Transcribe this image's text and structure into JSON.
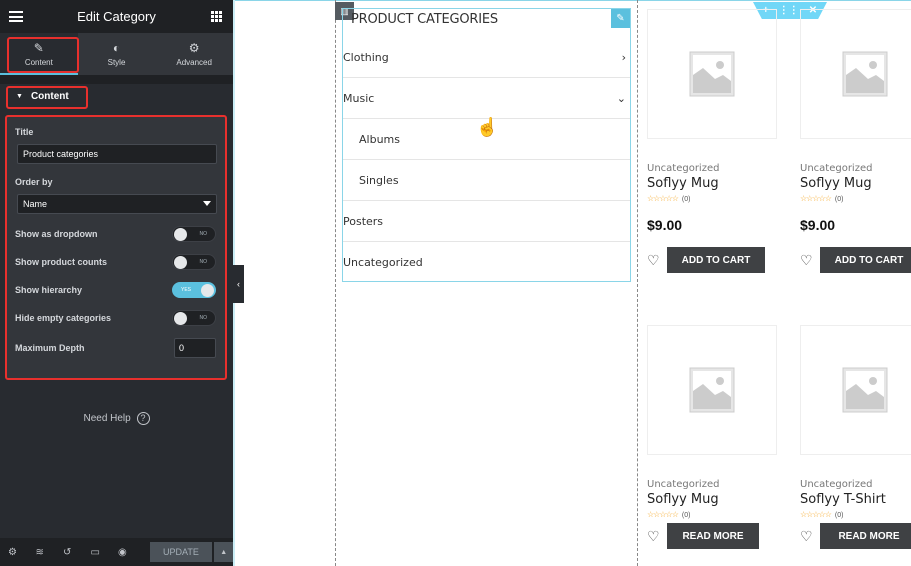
{
  "panel": {
    "title": "Edit Category",
    "tabs": [
      {
        "label": "Content",
        "icon": "pencil-icon",
        "active": true
      },
      {
        "label": "Style",
        "icon": "contrast-icon",
        "active": false
      },
      {
        "label": "Advanced",
        "icon": "gear-icon",
        "active": false
      }
    ],
    "section_title": "Content",
    "fields": {
      "title_label": "Title",
      "title_value": "Product categories",
      "order_label": "Order by",
      "order_value": "Name",
      "toggles": [
        {
          "label": "Show as dropdown",
          "state": "NO",
          "on": false
        },
        {
          "label": "Show product counts",
          "state": "NO",
          "on": false
        },
        {
          "label": "Show hierarchy",
          "state": "YES",
          "on": true
        },
        {
          "label": "Hide empty categories",
          "state": "NO",
          "on": false
        }
      ],
      "depth_label": "Maximum Depth",
      "depth_value": "0"
    },
    "help": "Need Help",
    "footer": {
      "icons": [
        "settings-icon",
        "layers-icon",
        "history-icon",
        "responsive-icon",
        "preview-icon"
      ],
      "update_label": "UPDATE"
    }
  },
  "widget": {
    "title": "PRODUCT CATEGORIES",
    "categories": [
      {
        "label": "Clothing",
        "child": false,
        "chevron": "›"
      },
      {
        "label": "Music",
        "child": false,
        "chevron": "⌄"
      },
      {
        "label": "Albums",
        "child": true,
        "chevron": ""
      },
      {
        "label": "Singles",
        "child": true,
        "chevron": ""
      },
      {
        "label": "Posters",
        "child": false,
        "chevron": ""
      },
      {
        "label": "Uncategorized",
        "child": false,
        "chevron": ""
      }
    ]
  },
  "products": [
    {
      "category": "Uncategorized",
      "name": "Soflyy Mug",
      "rating_count": "(0)",
      "price": "$9.00",
      "button": "ADD TO CART"
    },
    {
      "category": "Uncategorized",
      "name": "Soflyy Mug",
      "rating_count": "(0)",
      "price": "$9.00",
      "button": "ADD TO CART"
    },
    {
      "category": "Uncategorized",
      "name": "Soflyy Mug",
      "rating_count": "(0)",
      "price": "",
      "button": "READ MORE"
    },
    {
      "category": "Uncategorized",
      "name": "Soflyy T-Shirt",
      "rating_count": "(0)",
      "price": "",
      "button": "READ MORE"
    }
  ],
  "colors": {
    "accent": "#5bc0de",
    "highlight": "#e8302d",
    "panel_bg": "#282b30"
  }
}
